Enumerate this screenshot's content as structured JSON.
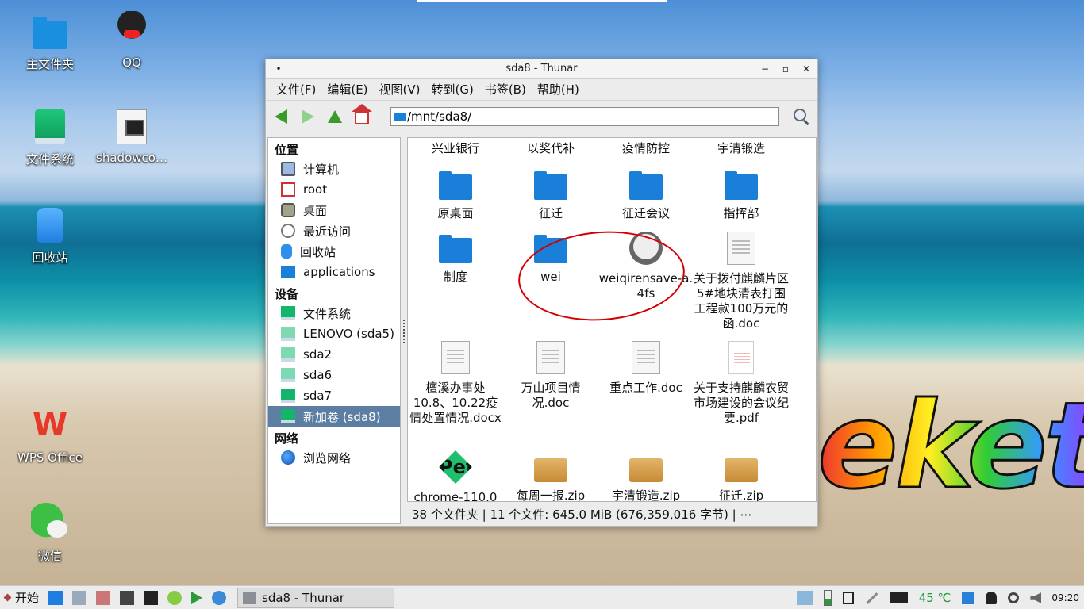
{
  "desktop": {
    "icons": [
      {
        "label": "主文件夹",
        "icon": "home-folder-icon"
      },
      {
        "label": "QQ",
        "icon": "qq-penguin-icon"
      },
      {
        "label": "文件系统",
        "icon": "drive-icon"
      },
      {
        "label": "shadowco…",
        "icon": "script-file-icon"
      },
      {
        "label": "回收站",
        "icon": "trash-icon"
      },
      {
        "label": "WPS Office",
        "icon": "wps-icon"
      },
      {
        "label": "微信",
        "icon": "wechat-icon"
      }
    ],
    "wallpaper_text": "eket"
  },
  "window": {
    "title": "sda8 - Thunar",
    "controls": [
      "•",
      "−",
      "▫",
      "✕"
    ],
    "menu": [
      "文件(F)",
      "编辑(E)",
      "视图(V)",
      "转到(G)",
      "书签(B)",
      "帮助(H)"
    ],
    "path": "/mnt/sda8/",
    "sidebar": {
      "places_header": "位置",
      "places": [
        "计算机",
        "root",
        "桌面",
        "最近访问",
        "回收站",
        "applications"
      ],
      "devices_header": "设备",
      "devices": [
        "文件系统",
        "LENOVO (sda5)",
        "sda2",
        "sda6",
        "sda7",
        "新加卷 (sda8)"
      ],
      "network_header": "网络",
      "network": [
        "浏览网络"
      ]
    },
    "files": [
      {
        "name": "兴业银行",
        "type": "folder"
      },
      {
        "name": "以奖代补",
        "type": "folder"
      },
      {
        "name": "疫情防控",
        "type": "folder"
      },
      {
        "name": "宇清锻造",
        "type": "folder"
      },
      {
        "name": "原桌面",
        "type": "folder"
      },
      {
        "name": "征迁",
        "type": "folder"
      },
      {
        "name": "征迁会议",
        "type": "folder"
      },
      {
        "name": "指挥部",
        "type": "folder"
      },
      {
        "name": "制度",
        "type": "folder"
      },
      {
        "name": "wei",
        "type": "folder"
      },
      {
        "name": "weiqirensave-a.4fs",
        "type": "puppy"
      },
      {
        "name": "关于拨付麒麟片区5#地块清表打围工程款100万元的函.doc",
        "type": "doc"
      },
      {
        "name": "檀溪办事处10.8、10.22疫情处置情况.docx",
        "type": "doc"
      },
      {
        "name": "万山项目情况.doc",
        "type": "doc"
      },
      {
        "name": "重点工作.doc",
        "type": "doc"
      },
      {
        "name": "关于支持麒麟农贸市场建设的会议纪要.pdf",
        "type": "pdf"
      },
      {
        "name": "chrome-110.0",
        "type": "pet"
      },
      {
        "name": "每周一报.zip",
        "type": "zip"
      },
      {
        "name": "宇清锻造.zip",
        "type": "zip"
      },
      {
        "name": "征迁.zip",
        "type": "zip"
      }
    ],
    "status": "38 个文件夹  |  11 个文件: 645.0 MiB (676,359,016 字节)  |  ⋯"
  },
  "taskbar": {
    "start": "开始",
    "task": "sda8 - Thunar",
    "temperature": "45 ℃",
    "time": "09:20"
  }
}
